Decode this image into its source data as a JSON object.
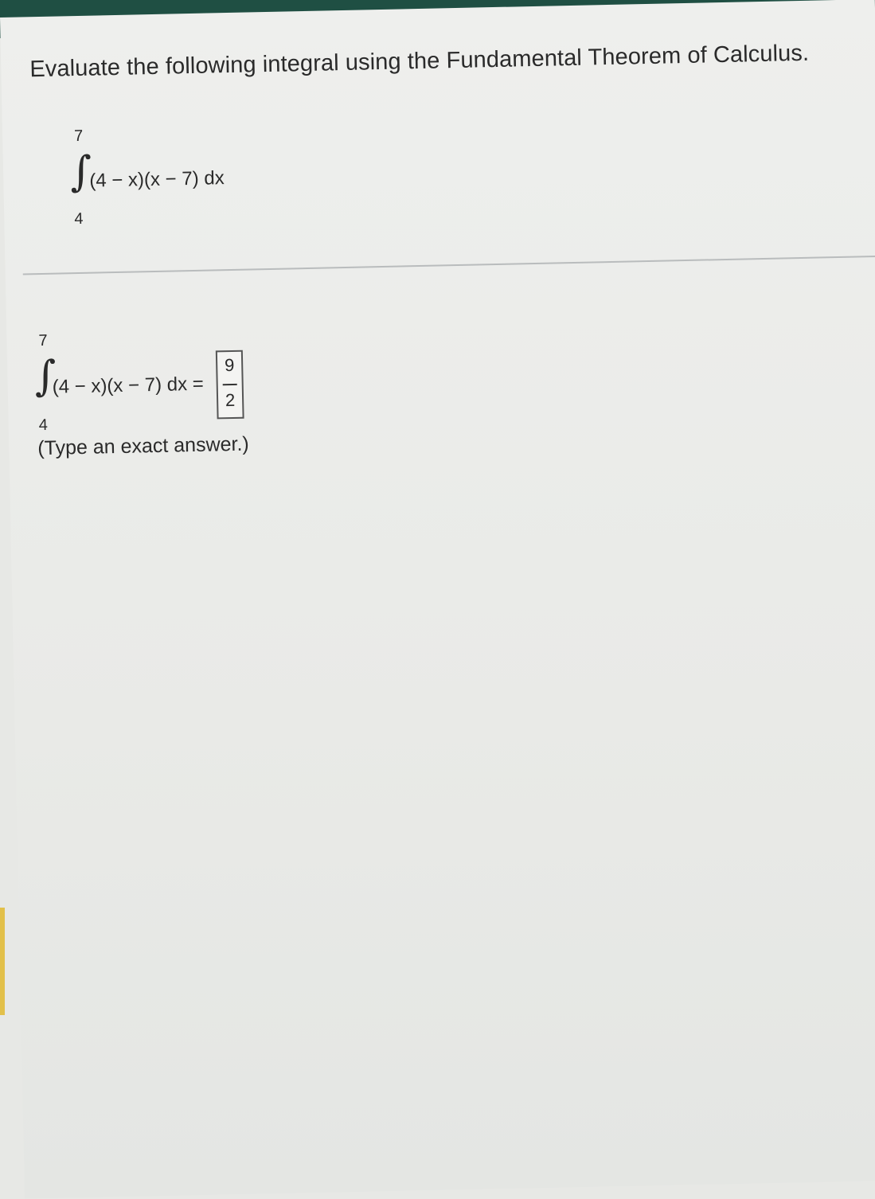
{
  "question": {
    "text": "Evaluate the following integral using the Fundamental Theorem of Calculus."
  },
  "problem_integral": {
    "upper": "7",
    "lower": "4",
    "integrand": "(4 − x)(x − 7) dx"
  },
  "answer_integral": {
    "upper": "7",
    "lower": "4",
    "integrand": "(4 − x)(x − 7) dx ="
  },
  "answer": {
    "numerator": "9",
    "denominator": "2"
  },
  "hint": "(Type an exact answer.)"
}
